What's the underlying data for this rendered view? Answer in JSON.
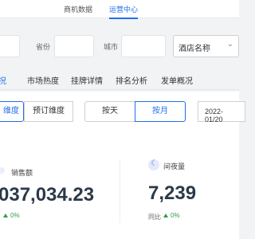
{
  "topnav": {
    "tabs": [
      {
        "label": "商机数据"
      },
      {
        "label": "运营中心"
      }
    ]
  },
  "filters": {
    "province_label": "省份",
    "city_label": "城市",
    "hotel_select": "酒店名称"
  },
  "subtabs": [
    {
      "label": "况"
    },
    {
      "label": "市场热度"
    },
    {
      "label": "挂牌详情"
    },
    {
      "label": "排名分析"
    },
    {
      "label": "发单概况"
    }
  ],
  "dimension_buttons": [
    {
      "label": "维度"
    },
    {
      "label": "预订维度"
    }
  ],
  "period_buttons": [
    {
      "label": "按天"
    },
    {
      "label": "按月"
    }
  ],
  "date_value": "2022-01/20",
  "metrics": {
    "sales": {
      "label": "销售额",
      "value": "037,034.23",
      "delta": "0%"
    },
    "room_nights": {
      "label": "间夜量",
      "value": "7,239",
      "compare_label": "同比",
      "delta": "0%"
    }
  },
  "colors": {
    "accent": "#1f6feb",
    "positive": "#2e9e44"
  }
}
